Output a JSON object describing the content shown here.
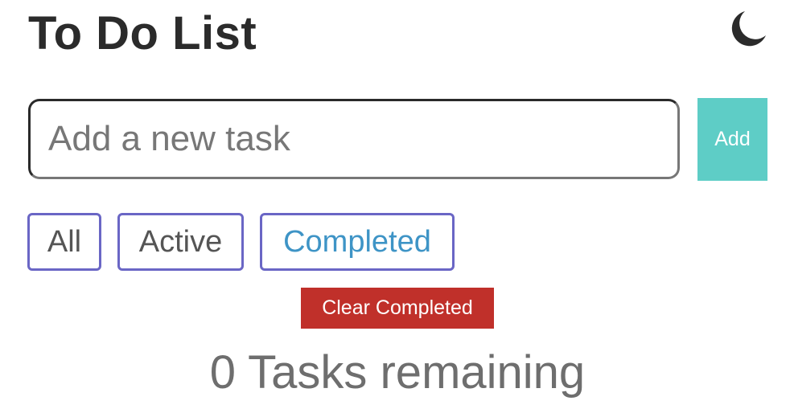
{
  "header": {
    "title": "To Do List",
    "theme_toggle_icon": "moon-icon"
  },
  "new_task": {
    "placeholder": "Add a new task",
    "value": "",
    "add_label": "Add"
  },
  "filters": {
    "all_label": "All",
    "active_label": "Active",
    "completed_label": "Completed",
    "selected": "Completed"
  },
  "clear_completed_label": "Clear Completed",
  "footer": {
    "remaining_text": "0 Tasks remaining"
  },
  "colors": {
    "add_button": "#5ecdc6",
    "clear_button": "#c0302a",
    "filter_border": "#6a66c5",
    "selected_filter_text": "#3e94c6"
  }
}
